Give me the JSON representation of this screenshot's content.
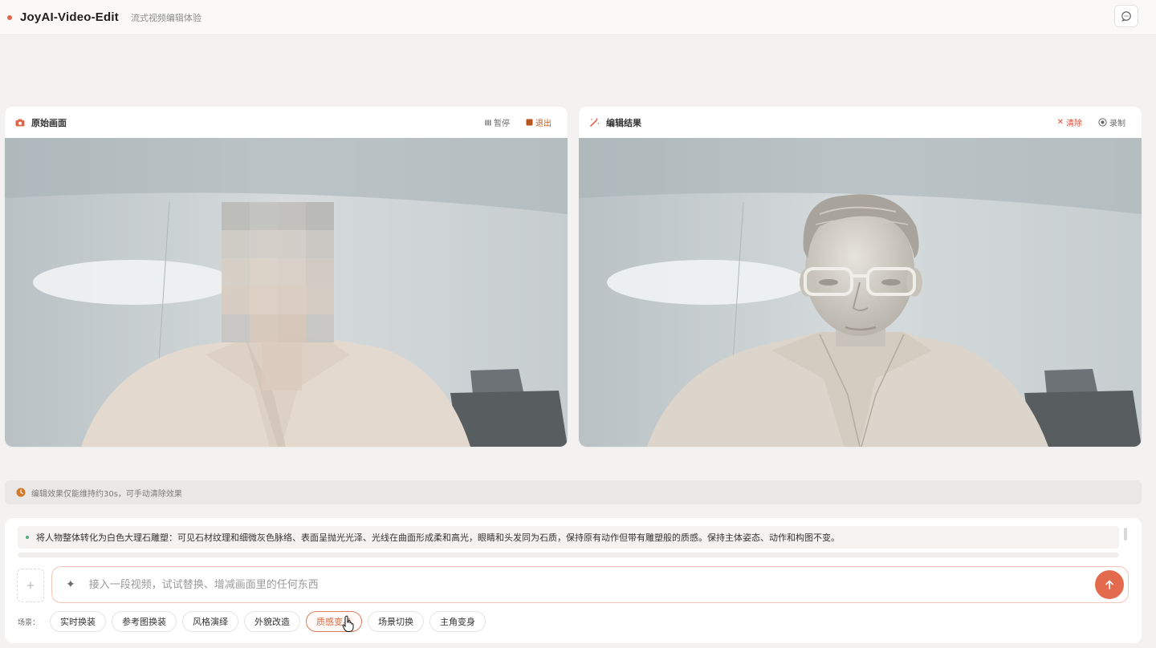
{
  "header": {
    "title": "JoyAI-Video-Edit",
    "subtitle": "流式视频编辑体验",
    "accent_color": "#e0664a"
  },
  "left_panel": {
    "title": "原始画面",
    "icon": "camera-icon",
    "actions": {
      "pause_label": "暂停",
      "exit_label": "退出"
    }
  },
  "right_panel": {
    "title": "编辑结果",
    "icon": "magic-wand-icon",
    "actions": {
      "clear_label": "清除",
      "record_label": "录制"
    }
  },
  "notice": {
    "icon": "clock-icon",
    "text": "编辑效果仅能维持约30s，可手动清除效果"
  },
  "composer": {
    "prompt_history": "将人物整体转化为白色大理石雕塑：可见石材纹理和细微灰色脉络、表面呈抛光光泽、光线在曲面形成柔和高光，眼睛和头发同为石质，保持原有动作但带有雕塑般的质感。保持主体姿态、动作和构图不变。",
    "input_placeholder": "接入一段视频，试试替换、增减画面里的任何东西",
    "send_color": "#e36a4c"
  },
  "scenes": {
    "label": "场景：",
    "items": [
      "实时换装",
      "参考图换装",
      "风格演绎",
      "外貌改造",
      "质感变身",
      "场景切换",
      "主角变身"
    ],
    "active": "质感变身"
  }
}
